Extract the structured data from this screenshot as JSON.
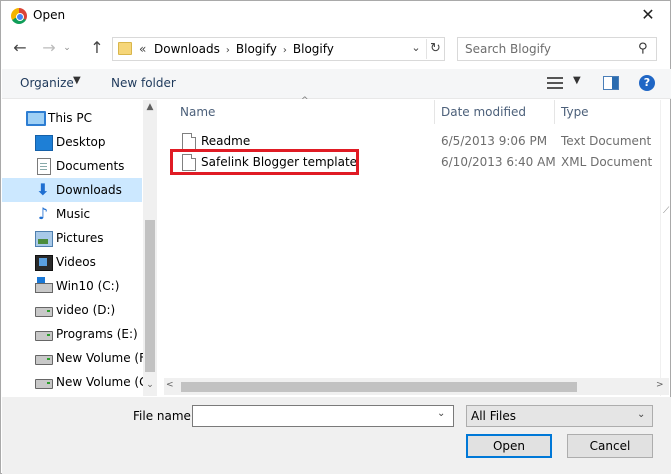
{
  "window": {
    "title": "Open"
  },
  "address": {
    "prefix": "«",
    "path": [
      "Downloads",
      "Blogify",
      "Blogify"
    ],
    "separator": "›"
  },
  "search": {
    "placeholder": "Search Blogify"
  },
  "toolbar": {
    "organize": "Organize",
    "new_folder": "New folder"
  },
  "sidebar": {
    "items": [
      {
        "label": "This PC",
        "icon": "computer-icon"
      },
      {
        "label": "Desktop",
        "icon": "desktop-icon"
      },
      {
        "label": "Documents",
        "icon": "documents-icon"
      },
      {
        "label": "Downloads",
        "icon": "downloads-icon",
        "selected": true
      },
      {
        "label": "Music",
        "icon": "music-icon"
      },
      {
        "label": "Pictures",
        "icon": "pictures-icon"
      },
      {
        "label": "Videos",
        "icon": "videos-icon"
      },
      {
        "label": "Win10 (C:)",
        "icon": "windows-drive-icon"
      },
      {
        "label": "video (D:)",
        "icon": "drive-icon"
      },
      {
        "label": "Programs (E:)",
        "icon": "drive-icon"
      },
      {
        "label": "New Volume (F:)",
        "icon": "drive-icon"
      },
      {
        "label": "New Volume (G:",
        "icon": "drive-icon"
      }
    ]
  },
  "columns": {
    "name": "Name",
    "date": "Date modified",
    "type": "Type"
  },
  "files": [
    {
      "name": "Readme",
      "date": "6/5/2013 9:06 PM",
      "type": "Text Document"
    },
    {
      "name": "Safelink Blogger template",
      "date": "6/10/2013 6:40 AM",
      "type": "XML Document",
      "highlighted": true
    }
  ],
  "bottom": {
    "file_name_label": "File name:",
    "file_name_value": "",
    "filter_value": "All Files",
    "open_label": "Open",
    "cancel_label": "Cancel"
  },
  "colors": {
    "highlight": "#e01b24",
    "selection": "#cce8ff",
    "accent": "#0078d7"
  }
}
